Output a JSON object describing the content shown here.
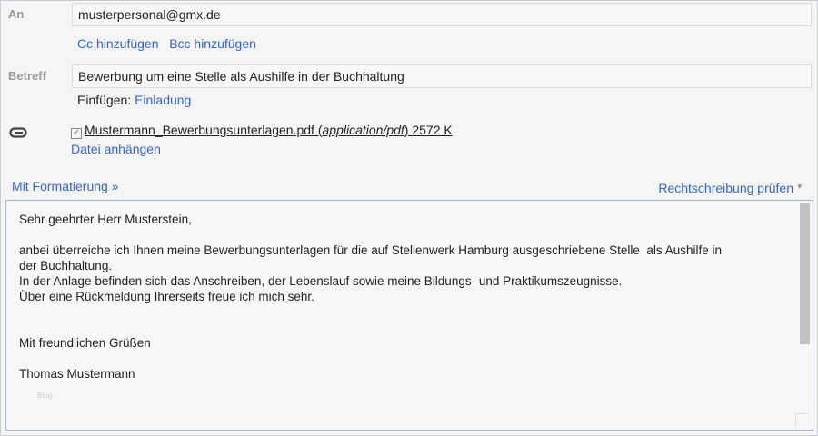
{
  "to": {
    "label": "An",
    "value": "musterpersonal@gmx.de",
    "add_cc": "Cc hinzufügen",
    "add_bcc": "Bcc hinzufügen"
  },
  "subject": {
    "label": "Betreff",
    "value": "Bewerbung um eine Stelle als Aushilfe in der Buchhaltung",
    "insert_label": "Einfügen:",
    "insert_link": "Einladung"
  },
  "attachment": {
    "filename": "Mustermann_Bewerbungsunterlagen.pdf",
    "open_paren": " (",
    "mime": "application/pdf",
    "close_paren": ")",
    "size": " 2572 K",
    "attach_link": "Datei anhängen",
    "icon": "paperclip-icon"
  },
  "toolbar": {
    "formatting": "Mit Formatierung »",
    "spellcheck": "Rechtschreibung prüfen"
  },
  "body": {
    "text": "Sehr geehrter Herr Musterstein,\n\nanbei überreiche ich Ihnen meine Bewerbungsunterlagen für die auf Stellenwerk Hamburg ausgeschriebene Stelle  als Aushilfe in\nder Buchhaltung.\nIn der Anlage befinden sich das Anschreiben, der Lebenslauf sowie meine Bildungs- und Praktikumszeugnisse.\nÜber eine Rückmeldung Ihrerseits freue ich mich sehr.\n\n\nMit freundlichen Grüßen\n\nThomas Mustermann",
    "watermark": "Blog"
  }
}
